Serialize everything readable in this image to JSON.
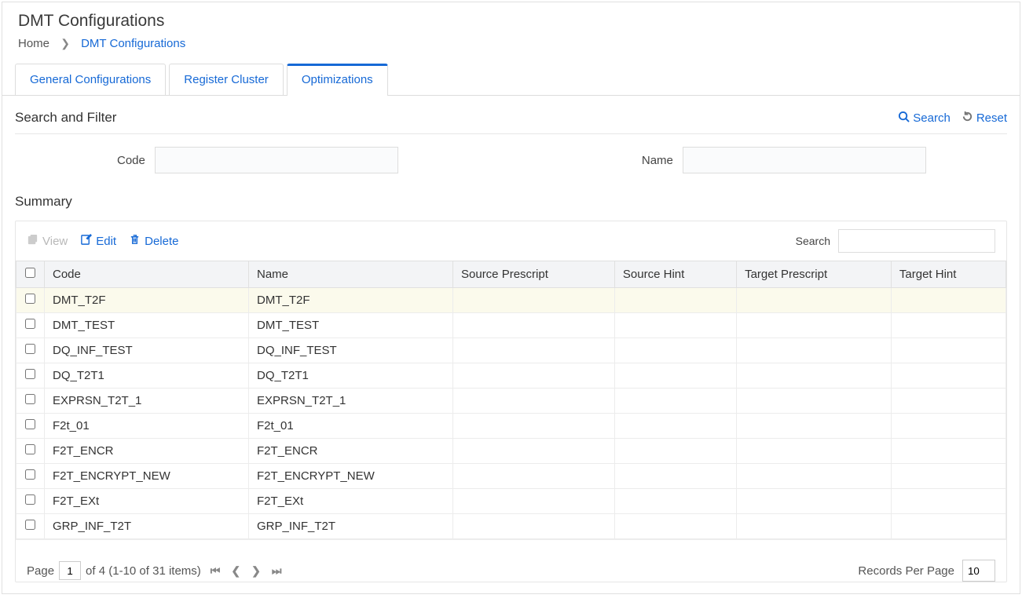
{
  "page": {
    "title": "DMT Configurations"
  },
  "breadcrumb": {
    "home": "Home",
    "current": "DMT Configurations"
  },
  "tabs": {
    "general": "General Configurations",
    "register": "Register Cluster",
    "optimizations": "Optimizations"
  },
  "search_filter": {
    "title": "Search and Filter",
    "search_label": "Search",
    "reset_label": "Reset",
    "code_label": "Code",
    "name_label": "Name",
    "code_value": "",
    "name_value": ""
  },
  "summary": {
    "title": "Summary"
  },
  "toolbar": {
    "view": "View",
    "edit": "Edit",
    "delete": "Delete",
    "search_label": "Search",
    "search_value": ""
  },
  "columns": {
    "code": "Code",
    "name": "Name",
    "src_prescript": "Source Prescript",
    "src_hint": "Source Hint",
    "tgt_prescript": "Target Prescript",
    "tgt_hint": "Target Hint"
  },
  "rows": [
    {
      "code": "DMT_T2F",
      "name": "DMT_T2F",
      "src_prescript": "",
      "src_hint": "",
      "tgt_prescript": "",
      "tgt_hint": "",
      "highlight": true
    },
    {
      "code": "DMT_TEST",
      "name": "DMT_TEST",
      "src_prescript": "",
      "src_hint": "",
      "tgt_prescript": "",
      "tgt_hint": ""
    },
    {
      "code": "DQ_INF_TEST",
      "name": "DQ_INF_TEST",
      "src_prescript": "",
      "src_hint": "",
      "tgt_prescript": "",
      "tgt_hint": ""
    },
    {
      "code": "DQ_T2T1",
      "name": "DQ_T2T1",
      "src_prescript": "",
      "src_hint": "",
      "tgt_prescript": "",
      "tgt_hint": ""
    },
    {
      "code": "EXPRSN_T2T_1",
      "name": "EXPRSN_T2T_1",
      "src_prescript": "",
      "src_hint": "",
      "tgt_prescript": "",
      "tgt_hint": ""
    },
    {
      "code": "F2t_01",
      "name": "F2t_01",
      "src_prescript": "",
      "src_hint": "",
      "tgt_prescript": "",
      "tgt_hint": ""
    },
    {
      "code": "F2T_ENCR",
      "name": "F2T_ENCR",
      "src_prescript": "",
      "src_hint": "",
      "tgt_prescript": "",
      "tgt_hint": ""
    },
    {
      "code": "F2T_ENCRYPT_NEW",
      "name": "F2T_ENCRYPT_NEW",
      "src_prescript": "",
      "src_hint": "",
      "tgt_prescript": "",
      "tgt_hint": ""
    },
    {
      "code": "F2T_EXt",
      "name": "F2T_EXt",
      "src_prescript": "",
      "src_hint": "",
      "tgt_prescript": "",
      "tgt_hint": ""
    },
    {
      "code": "GRP_INF_T2T",
      "name": "GRP_INF_T2T",
      "src_prescript": "",
      "src_hint": "",
      "tgt_prescript": "",
      "tgt_hint": ""
    }
  ],
  "pagination": {
    "page_label": "Page",
    "page_value": "1",
    "of_text": "of 4 (1-10 of 31 items)",
    "records_label": "Records Per Page",
    "records_value": "10"
  }
}
